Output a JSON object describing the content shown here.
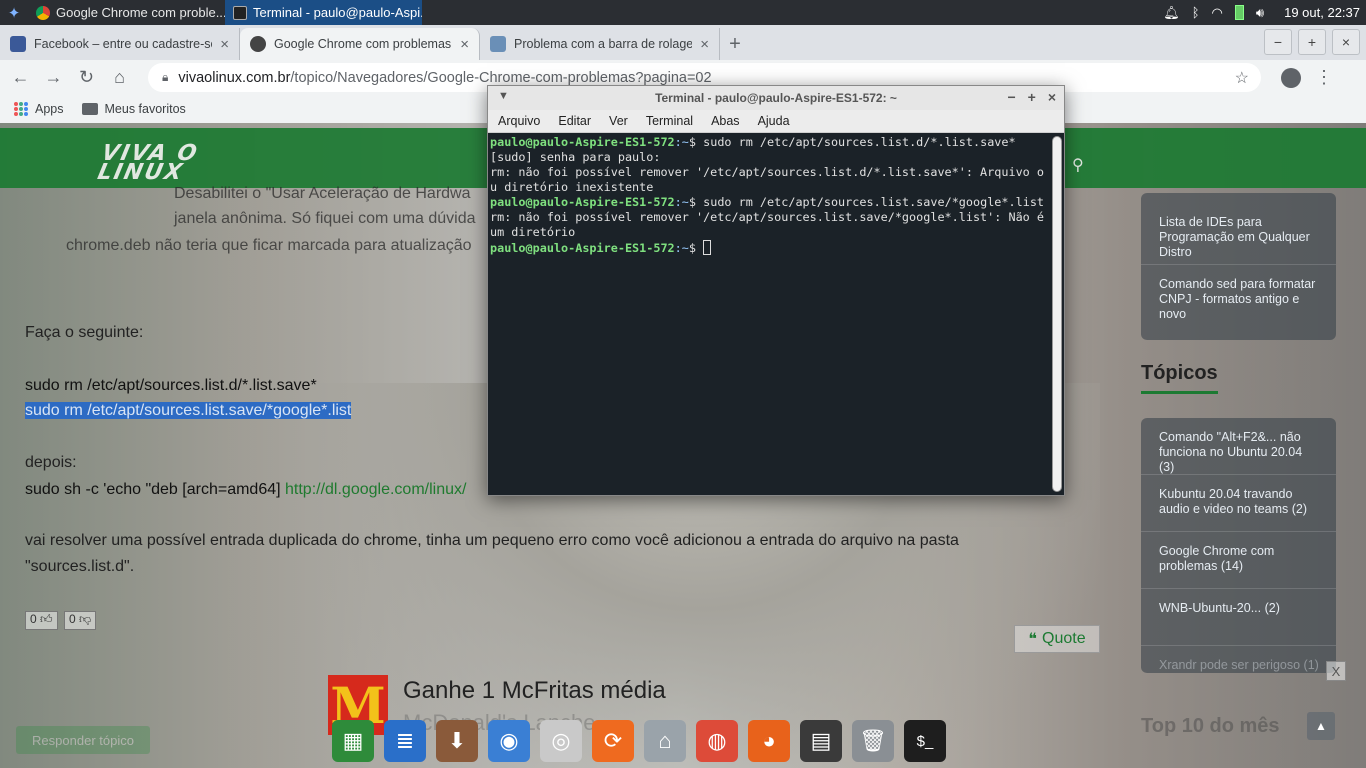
{
  "panel": {
    "tasks": [
      {
        "label": "Google Chrome com proble...",
        "active": false
      },
      {
        "label": "Terminal - paulo@paulo-Aspi...",
        "active": true
      }
    ],
    "clock": "19 out, 22:37"
  },
  "browser": {
    "tabs": [
      {
        "label": "Facebook – entre ou cadastre-se",
        "close": "×"
      },
      {
        "label": "Google Chrome com problemas",
        "close": "×"
      },
      {
        "label": "Problema com a barra de rolage",
        "close": "×"
      }
    ],
    "new_tab": "+",
    "url_host": "vivaolinux.com.br",
    "url_path": "/topico/Navegadores/Google-Chrome-com-problemas?pagina=02",
    "bookmarks": [
      {
        "label": "Apps"
      },
      {
        "label": "Meus favoritos"
      }
    ]
  },
  "site": {
    "logo_top": "VIVA O",
    "logo_bottom": "LINUX",
    "post": {
      "line1": "Desabilitei o \"Usar Aceleração de Hardwa",
      "line2": "janela anônima. Só fiquei com uma dúvida",
      "line3": "chrome.deb não teria que ficar marcada para atualização",
      "intro": "Faça o seguinte:",
      "cmd1": "sudo rm /etc/apt/sources.list.d/*.list.save*",
      "cmd2": "sudo rm /etc/apt/sources.list.save/*google*.list",
      "after": "depois:",
      "cmd3_prefix": "sudo sh -c 'echo \"deb [arch=amd64] ",
      "cmd3_link": "http://dl.google.com/linux/",
      "result1": "vai resolver uma possível entrada duplicada do chrome, tinha um pequeno erro como você adicionou a entrada do arquivo na pasta",
      "result2": "\"sources.list.d\".",
      "upvote": "0",
      "downvote": "0",
      "quote": "Quote",
      "reply": "Responder tópico"
    },
    "sidebar": {
      "articles": [
        "Lista de IDEs para Programação em Qualquer Distro",
        "Comando sed para formatar CNPJ - formatos antigo e novo"
      ],
      "topics_title": "Tópicos",
      "topics": [
        "Comando \"Alt+F2&... não funciona no Ubuntu 20.04 (3)",
        "Kubuntu 20.04 travando audio e video no teams (2)",
        "Google Chrome com problemas (14)",
        "WNB-Ubuntu-20... (2)",
        "Xrandr pode ser perigoso (1)"
      ],
      "top10": "Top 10 do mês"
    },
    "ad": {
      "title": "Ganhe 1 McFritas média",
      "subtitle": "McDonald's Lanche",
      "close": "X"
    }
  },
  "terminal": {
    "title": "Terminal - paulo@paulo-Aspire-ES1-572: ~",
    "menu": [
      "Arquivo",
      "Editar",
      "Ver",
      "Terminal",
      "Abas",
      "Ajuda"
    ],
    "prompt": "paulo@paulo-Aspire-ES1-572",
    "lines": [
      {
        "cmd": "sudo rm /etc/apt/sources.list.d/*.list.save*"
      },
      {
        "out": "[sudo] senha para paulo:"
      },
      {
        "out": "rm: não foi possível remover '/etc/apt/sources.list.d/*.list.save*': Arquivo ou diretório inexistente"
      },
      {
        "cmd": "sudo rm /etc/apt/sources.list.save/*google*.list"
      },
      {
        "out": "rm: não foi possível remover '/etc/apt/sources.list.save/*google*.list': Não é um diretório"
      }
    ]
  },
  "dock": [
    {
      "name": "spreadsheet-icon",
      "color": "#2e8b3a",
      "glyph": "▦"
    },
    {
      "name": "document-icon",
      "color": "#2a6fc9",
      "glyph": "≣"
    },
    {
      "name": "installer-icon",
      "color": "#8a5a3a",
      "glyph": "⬇"
    },
    {
      "name": "store-icon",
      "color": "#3a7fd4",
      "glyph": "◉"
    },
    {
      "name": "disc-icon",
      "color": "#c9c9c9",
      "glyph": "◎"
    },
    {
      "name": "update-icon",
      "color": "#ef6a1f",
      "glyph": "⟳"
    },
    {
      "name": "home-folder-icon",
      "color": "#9aa3aa",
      "glyph": "⌂"
    },
    {
      "name": "chrome-icon",
      "color": "#dd4b39",
      "glyph": "◍"
    },
    {
      "name": "firefox-icon",
      "color": "#e8621b",
      "glyph": "◕"
    },
    {
      "name": "calculator-icon",
      "color": "#3a3a3a",
      "glyph": "▤"
    },
    {
      "name": "trash-icon",
      "color": "#8a8f94",
      "glyph": "🗑"
    },
    {
      "name": "terminal-icon",
      "color": "#1e1e1e",
      "glyph": "$_"
    }
  ]
}
